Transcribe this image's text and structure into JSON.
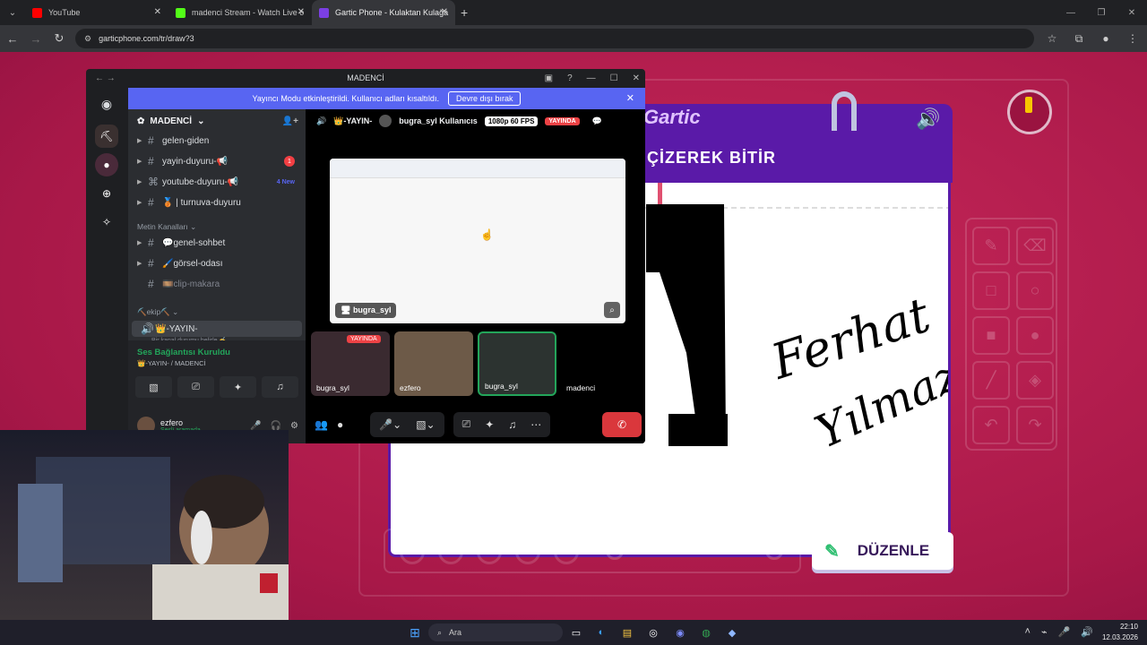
{
  "browser": {
    "tabs": [
      {
        "title": "YouTube",
        "color": "#ff0000"
      },
      {
        "title": "madenci Stream - Watch Live o",
        "color": "#53fc18"
      },
      {
        "title": "Gartic Phone - Kulaktan Kulağa",
        "color": "#7b3fe4"
      }
    ],
    "url": "garticphone.com/tr/draw?3"
  },
  "game": {
    "logo": "Gartic",
    "prompt": "ÇİZEREK BİTİR",
    "handwriting_line1": "Ferhat",
    "handwriting_line2": "Yılmaz",
    "edit_button": "DÜZENLE",
    "timer_remaining_fraction": 0.93
  },
  "discord": {
    "window_title": "MADENCİ",
    "banner_text": "Yayıncı Modu etkinleştirildi. Kullanıcı adları kısaltıldı.",
    "banner_button": "Devre dışı bırak",
    "server_name": "MADENCİ",
    "channels_top": [
      {
        "name": "gelen-giden",
        "badge": "",
        "new": ""
      },
      {
        "name": "yayin-duyuru-📢",
        "badge": "1",
        "new": ""
      },
      {
        "name": "youtube-duyuru-📢",
        "badge": "",
        "new": "4 New"
      },
      {
        "name": "🥉 | turnuva-duyuru",
        "badge": "",
        "new": ""
      }
    ],
    "category_text": "Metin Kanalları",
    "text_channels": [
      "💬genel-sohbet",
      "🖌️görsel-odası",
      "🎞️clip-makara"
    ],
    "category_ekip": "⛏️ekip⛏️",
    "voice_channel": "👑-YAYIN-",
    "voice_channel_status": "Bir kanal durumu belirle ✍",
    "voice_status": "Ses Bağlantısı Kuruldu",
    "voice_location": "👑-YAYIN- / MADENCİ",
    "user_name": "ezfero",
    "user_status": "Sesli aramada",
    "call": {
      "channel": "👑-YAYIN-",
      "streamer": "bugra_syl Kullanıcıs",
      "quality": "1080p 60 FPS",
      "live_label": "YAYINDA",
      "main_tag": "bugra_syl",
      "participants": [
        "bugra_syl",
        "ezfero",
        "bugra_syl",
        "madenci"
      ]
    }
  },
  "taskbar": {
    "search_placeholder": "Ara",
    "time": "22:10",
    "date": "12.03.2026"
  }
}
